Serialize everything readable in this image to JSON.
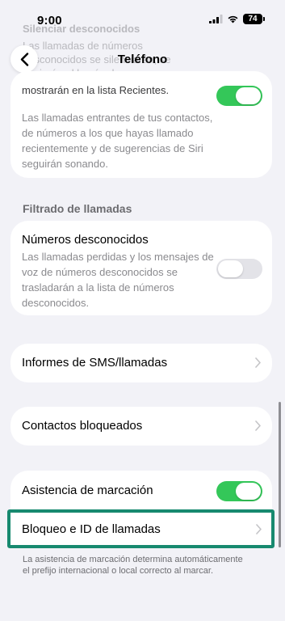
{
  "status_bar": {
    "time": "9:00",
    "battery": "74"
  },
  "nav": {
    "title": "Teléfono"
  },
  "faded_top": {
    "title": "Silenciar desconocidos",
    "text": "Las llamadas de números desconocidos se silenciarán, se enviarán al buzón de voz y se mostrarán en la lista Recientes."
  },
  "silence_card": {
    "visible_text": "mostrarán en la lista Recientes.",
    "toggle_on": true,
    "description": "Las llamadas entrantes de tus contactos, de números a los que hayas llamado recientemente y de sugerencias de Siri seguirán sonando."
  },
  "filter_section": {
    "header": "Filtrado de llamadas",
    "title": "Números desconocidos",
    "description": "Las llamadas perdidas y los mensajes de voz de números desconocidos se trasladarán a la lista de números desconocidos.",
    "toggle_on": false
  },
  "rows": {
    "sms_reports": "Informes de SMS/llamadas",
    "blocked_contacts": "Contactos bloqueados",
    "dial_assist": "Asistencia de marcación",
    "dial_assist_on": true,
    "call_blocking": "Bloqueo e ID de llamadas"
  },
  "footer": "La asistencia de marcación determina automáticamente el prefijo internacional o local correcto al marcar.",
  "colors": {
    "toggle_on": "#34c759",
    "toggle_off": "#e3e3e8",
    "highlight_border": "#17896f",
    "background": "#f2f2f7"
  }
}
